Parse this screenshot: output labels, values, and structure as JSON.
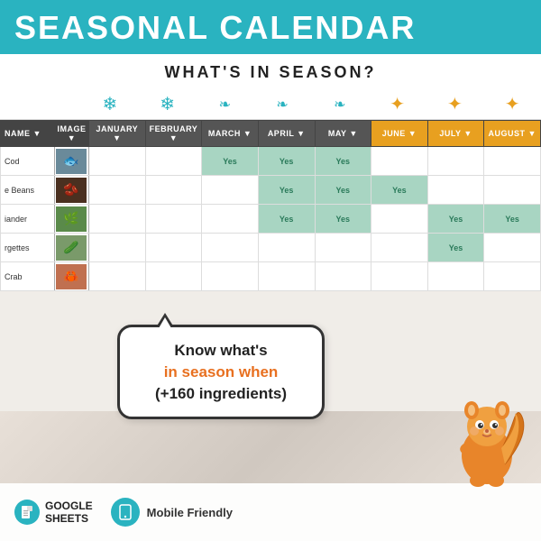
{
  "header": {
    "title": "SEASONAL CALENDA",
    "bg_color": "#2ab3c0"
  },
  "subtitle": {
    "text": "WHAT'S IN SEASON?"
  },
  "season_icons": [
    {
      "icon": "❄",
      "season": "winter",
      "col": "january"
    },
    {
      "icon": "❄",
      "season": "winter",
      "col": "february"
    },
    {
      "icon": "🌷",
      "season": "spring",
      "col": "march"
    },
    {
      "icon": "🌷",
      "season": "spring",
      "col": "april"
    },
    {
      "icon": "🌷",
      "season": "spring",
      "col": "may"
    },
    {
      "icon": "☀",
      "season": "summer",
      "col": "june"
    },
    {
      "icon": "☀",
      "season": "summer",
      "col": "july"
    },
    {
      "icon": "☀",
      "season": "summer",
      "col": "august"
    }
  ],
  "table": {
    "columns": [
      "NAME",
      "IMAGE",
      "JANUARY",
      "FEBRUARY",
      "MARCH",
      "APRIL",
      "MAY",
      "JUNE",
      "JULY",
      "AUGUST"
    ],
    "rows": [
      {
        "name": "Cod",
        "img_color": "#6a8a9a",
        "img_emoji": "🐟",
        "values": [
          "",
          "",
          "",
          "Yes",
          "Yes",
          "Yes",
          "",
          "",
          ""
        ]
      },
      {
        "name": "e Beans",
        "img_color": "#4a3020",
        "img_emoji": "🫘",
        "values": [
          "",
          "",
          "",
          "",
          "Yes",
          "Yes",
          "Yes",
          "",
          ""
        ]
      },
      {
        "name": "iander",
        "img_color": "#5a8a4a",
        "img_emoji": "🌿",
        "values": [
          "",
          "",
          "",
          "",
          "Yes",
          "Yes",
          "",
          "Yes",
          "Yes"
        ]
      },
      {
        "name": "rgettes",
        "img_color": "#7a9a6a",
        "img_emoji": "🥒",
        "values": [
          "",
          "",
          "",
          "",
          "",
          "",
          "",
          "Yes",
          ""
        ]
      },
      {
        "name": "Crab",
        "img_color": "#c07050",
        "img_emoji": "🦀",
        "values": [
          "",
          "",
          "",
          "",
          "",
          "",
          "",
          "",
          ""
        ]
      }
    ]
  },
  "speech_bubble": {
    "line1": "Know what's",
    "line2_plain": "",
    "line2_highlight": "in season when",
    "line3": "(+160 ingredients)"
  },
  "bottom_bar": {
    "google_sheets_line1": "GOOGLE",
    "google_sheets_line2": "SHEETS",
    "mobile_label": "Mobile Friendly"
  }
}
